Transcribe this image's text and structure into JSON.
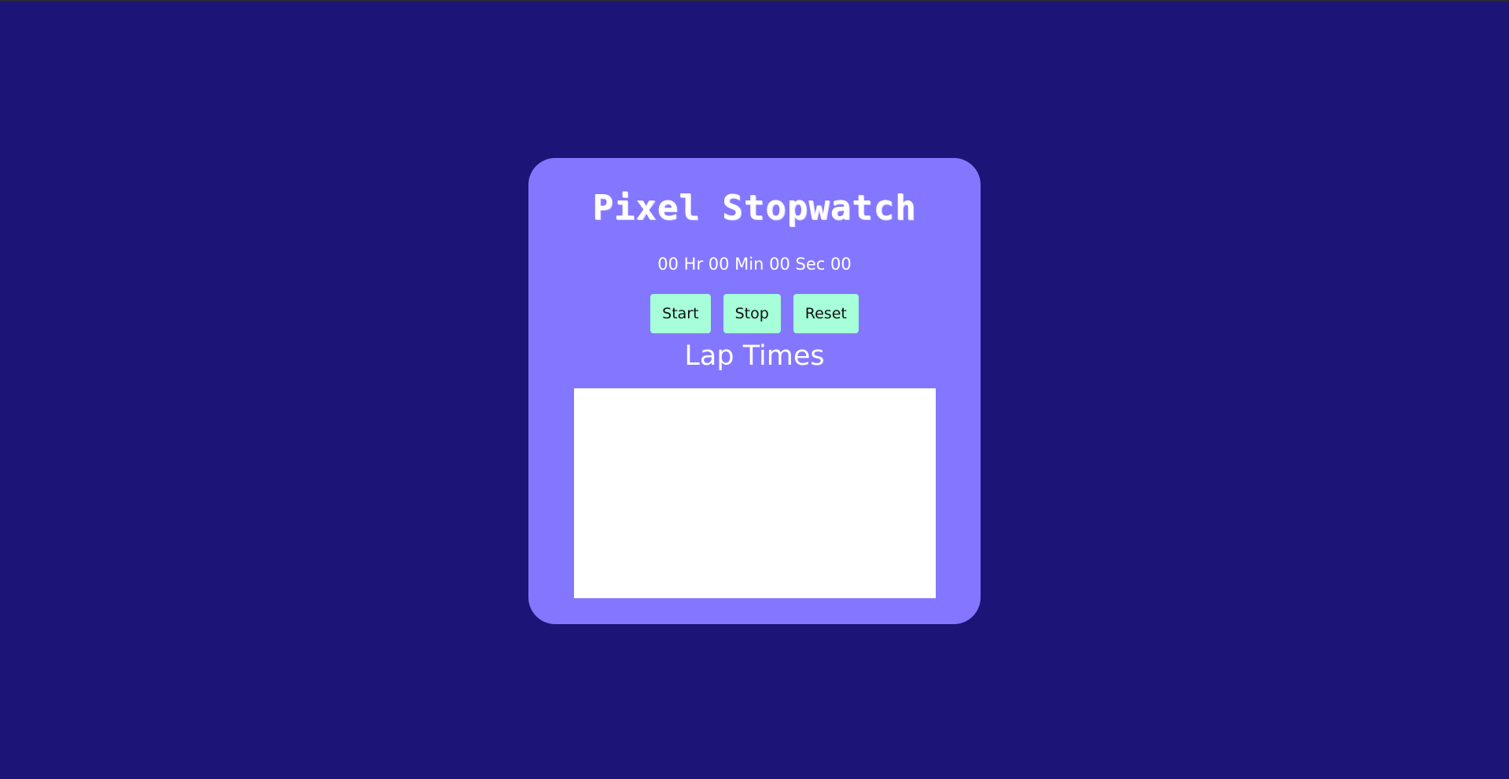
{
  "app": {
    "title": "Pixel Stopwatch"
  },
  "display": {
    "time_text": "00 Hr 00 Min 00 Sec 00"
  },
  "controls": {
    "start_label": "Start",
    "stop_label": "Stop",
    "reset_label": "Reset"
  },
  "laps": {
    "heading": "Lap Times",
    "items": []
  },
  "colors": {
    "background": "#1c1577",
    "card": "#8477ff",
    "button": "#a6ffd9",
    "lap_panel": "#ffffff",
    "text": "#ffffff"
  }
}
